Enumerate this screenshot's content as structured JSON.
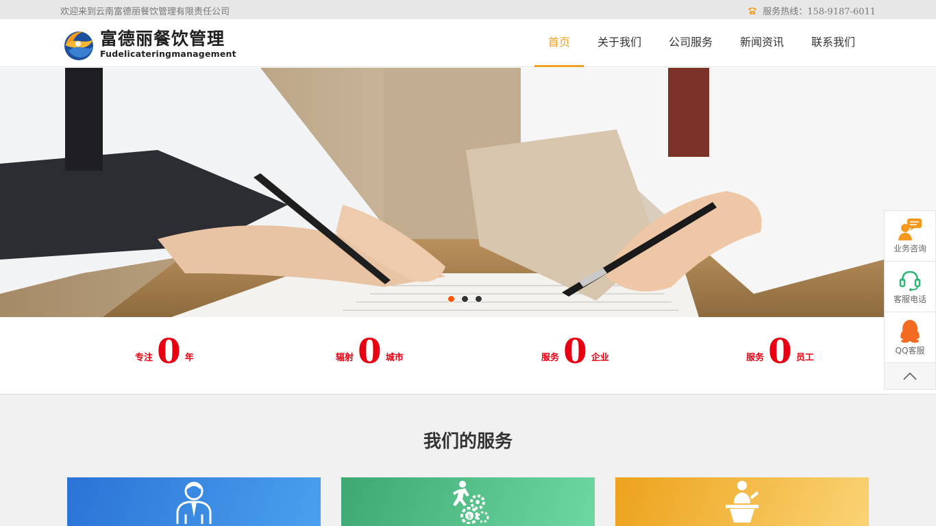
{
  "topbar": {
    "welcome": "欢迎来到云南富德丽餐饮管理有限责任公司",
    "hotline": "服务热线：158-9187-6011"
  },
  "logo": {
    "name_cn": "富德丽餐饮管理",
    "name_en": "Fudelicateringmanagement"
  },
  "nav": {
    "items": [
      {
        "label": "首页",
        "active": true
      },
      {
        "label": "关于我们",
        "active": false
      },
      {
        "label": "公司服务",
        "active": false
      },
      {
        "label": "新闻资讯",
        "active": false
      },
      {
        "label": "联系我们",
        "active": false
      }
    ]
  },
  "banner": {
    "slide_count": 3,
    "active_slide": 1
  },
  "stats": [
    {
      "prefix": "专注",
      "value": "0",
      "suffix": "年"
    },
    {
      "prefix": "辐射",
      "value": "0",
      "suffix": "城市"
    },
    {
      "prefix": "服务",
      "value": "0",
      "suffix": "企业"
    },
    {
      "prefix": "服务",
      "value": "0",
      "suffix": "员工"
    }
  ],
  "services": {
    "title": "我们的服务",
    "cards": [
      {
        "icon": "business-person-icon",
        "color_from": "#2a73d6",
        "color_to": "#4aa0ee"
      },
      {
        "icon": "growth-gears-icon",
        "color_from": "#3ea872",
        "color_to": "#6fd8a2"
      },
      {
        "icon": "speaker-podium-icon",
        "color_from": "#eda21c",
        "color_to": "#fad374"
      }
    ]
  },
  "sidepanel": {
    "consult_label": "业务咨询",
    "phone_label": "客服电话",
    "qq_label": "QQ客服"
  },
  "colors": {
    "accent": "#f0a020",
    "stat_red": "#e60012",
    "active_dot": "#ff5500"
  }
}
